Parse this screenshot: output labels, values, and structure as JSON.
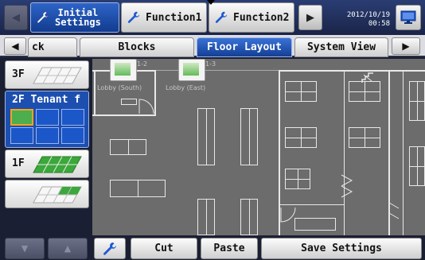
{
  "top_bar": {
    "tabs": [
      {
        "label_line1": "Initial",
        "label_line2": "Settings"
      },
      {
        "label": "Function1"
      },
      {
        "label": "Function2"
      }
    ],
    "clock": {
      "date": "2012/10/19",
      "time": "00:58"
    }
  },
  "sub_tabs": {
    "items": [
      "ck",
      "Blocks",
      "Floor Layout",
      "System View"
    ],
    "active": "Floor Layout"
  },
  "floors": [
    {
      "name": "3F"
    },
    {
      "name": "2F Tenant f"
    },
    {
      "name": "1F"
    },
    {
      "name": ""
    }
  ],
  "layout": {
    "units": [
      {
        "id": "1-2",
        "label": "Lobby (South)"
      },
      {
        "id": "1-3",
        "label": "Lobby (East)"
      }
    ]
  },
  "bottom_bar": {
    "cut_label": "Cut",
    "paste_label": "Paste",
    "save_label": "Save Settings"
  },
  "colors": {
    "header_bg": "#1a2447",
    "active_tab": "#1d4fb0",
    "canvas_bg": "#6c6c6c",
    "unit_green": "#63bb5a"
  },
  "icons": [
    "wrench-icon",
    "monitor-icon",
    "chevron-left-icon",
    "chevron-right-icon",
    "chevron-up-icon",
    "chevron-down-icon",
    "stairs-icon"
  ]
}
